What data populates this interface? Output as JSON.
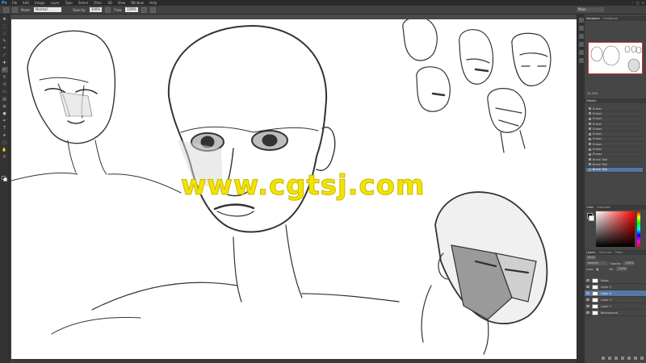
{
  "app": {
    "logo": "Ps"
  },
  "menu": [
    "File",
    "Edit",
    "Image",
    "Layer",
    "Type",
    "Select",
    "Filter",
    "3D",
    "View",
    "Window",
    "Help"
  ],
  "window_controls": [
    "–",
    "□",
    "×"
  ],
  "options_bar": {
    "mode_label": "Mode:",
    "mode_value": "Normal",
    "opacity_label": "Opacity:",
    "opacity_value": "100%",
    "flow_label": "Flow:",
    "flow_value": "100%",
    "workspace": "Main"
  },
  "navigator": {
    "tabs": [
      "Navigator",
      "Histogram"
    ],
    "zoom": "33.33%"
  },
  "history": {
    "tabs": [
      "History"
    ],
    "items": [
      "Eraser",
      "Eraser",
      "Eraser",
      "Eraser",
      "Eraser",
      "Eraser",
      "Eraser",
      "Eraser",
      "Eraser",
      "Eraser",
      "Brush Tool",
      "Brush Tool",
      "Brush Tool"
    ],
    "selected_index": 12
  },
  "color": {
    "tabs": [
      "Color",
      "Swatches"
    ]
  },
  "layers": {
    "tabs": [
      "Layers",
      "Channels",
      "Paths"
    ],
    "kind_label": "Kind",
    "blend_mode": "Normal",
    "opacity_label": "Opacity:",
    "opacity_value": "100%",
    "lock_label": "Lock:",
    "fill_label": "Fill:",
    "fill_value": "100%",
    "items": [
      "Noise",
      "Layer 2",
      "Layer 4",
      "Layer 3",
      "Layer 1",
      "Background"
    ],
    "selected_index": 2
  },
  "watermark": "www.cgtsj.com",
  "colors": {
    "accent_selection": "#5677a3",
    "watermark": "#f2e400"
  }
}
